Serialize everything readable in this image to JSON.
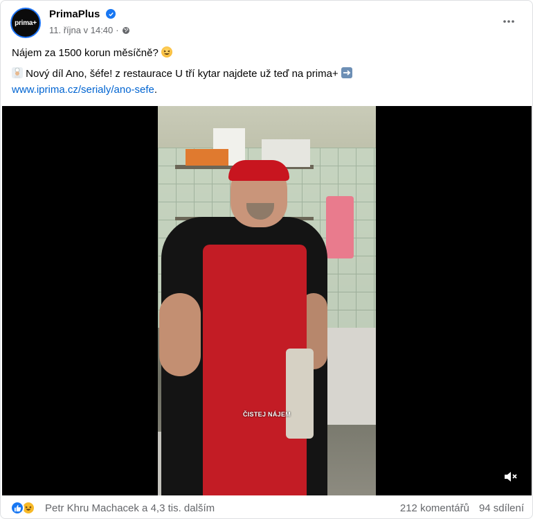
{
  "post": {
    "page_name": "PrimaPlus",
    "avatar_text": "prima+",
    "timestamp": "11. října v 14:40",
    "separator": "·",
    "line1": "Nájem za 1500 korun měsíčně? ",
    "line2": " Nový díl Ano, šéfe! z restaurace U tří kytar najdete už teď na prima+ ",
    "link": "www.iprima.cz/serialy/ano-sefe",
    "link_suffix": "."
  },
  "video": {
    "caption": "ČISTEJ NÁJEM",
    "muted": true
  },
  "footer": {
    "reactors": "Petr Khru Machacek a 4,3 tis. dalším",
    "comments": "212 komentářů",
    "shares": "94 sdílení"
  },
  "colors": {
    "accent": "#1877f2",
    "link": "#0064d1",
    "muted_text": "#65676b"
  }
}
